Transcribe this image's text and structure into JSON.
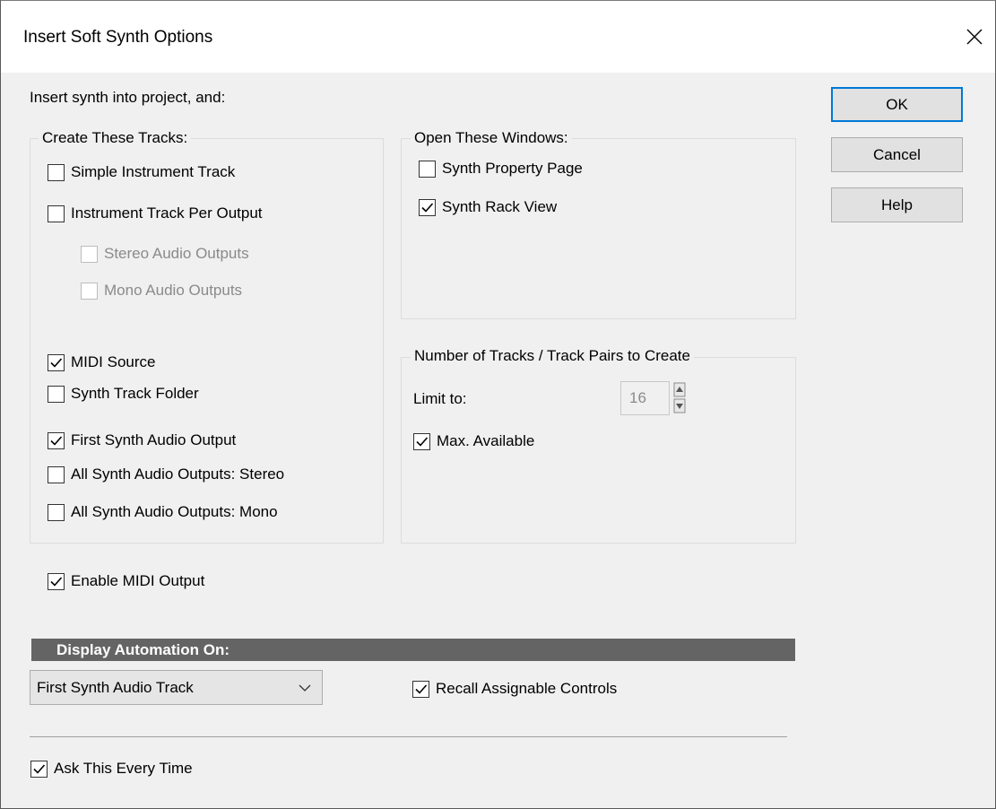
{
  "dialog": {
    "title": "Insert Soft Synth Options"
  },
  "intro": "Insert synth into project, and:",
  "buttons": {
    "ok": "OK",
    "cancel": "Cancel",
    "help": "Help"
  },
  "create_tracks": {
    "title": "Create These Tracks:",
    "items": [
      {
        "label": "Simple Instrument Track",
        "checked": false,
        "enabled": true
      },
      {
        "label": "Instrument Track Per Output",
        "checked": false,
        "enabled": true
      },
      {
        "label": "Stereo Audio Outputs",
        "checked": false,
        "enabled": false
      },
      {
        "label": "Mono Audio Outputs",
        "checked": false,
        "enabled": false
      },
      {
        "label": "MIDI Source",
        "checked": true,
        "enabled": true
      },
      {
        "label": "Synth Track Folder",
        "checked": false,
        "enabled": true
      },
      {
        "label": "First Synth Audio Output",
        "checked": true,
        "enabled": true
      },
      {
        "label": "All Synth Audio Outputs: Stereo",
        "checked": false,
        "enabled": true
      },
      {
        "label": "All Synth Audio Outputs: Mono",
        "checked": false,
        "enabled": true
      }
    ]
  },
  "open_windows": {
    "title": "Open These Windows:",
    "items": [
      {
        "label": "Synth Property Page",
        "checked": false,
        "enabled": true
      },
      {
        "label": "Synth Rack View",
        "checked": true,
        "enabled": true
      }
    ]
  },
  "num_tracks": {
    "title": "Number of Tracks / Track Pairs to Create",
    "limit_label": "Limit to:",
    "limit_value": "16",
    "max_available": {
      "label": "Max. Available",
      "checked": true,
      "enabled": true
    }
  },
  "enable_midi_output": {
    "label": "Enable MIDI Output",
    "checked": true,
    "enabled": true
  },
  "display_automation": {
    "header": "Display Automation On:",
    "selected": "First Synth Audio Track"
  },
  "recall_controls": {
    "label": "Recall Assignable Controls",
    "checked": true,
    "enabled": true
  },
  "ask_every_time": {
    "label": "Ask This Every Time",
    "checked": true,
    "enabled": true
  }
}
